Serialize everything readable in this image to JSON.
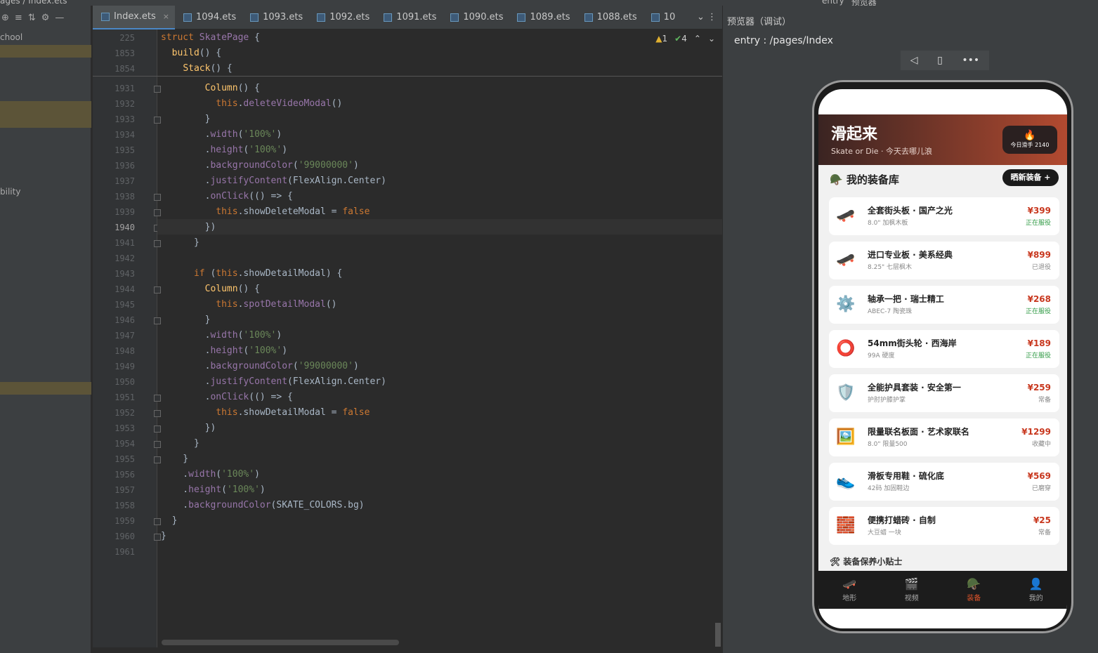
{
  "breadcrumb": {
    "part1": "ages",
    "part2": "Index.ets"
  },
  "topbar": {
    "entry": "entry",
    "previewer": "预览器"
  },
  "project": {
    "row1": "chool",
    "row2": "bility"
  },
  "tabs": [
    {
      "label": "Index.ets",
      "active": true
    },
    {
      "label": "1094.ets"
    },
    {
      "label": "1093.ets"
    },
    {
      "label": "1092.ets"
    },
    {
      "label": "1091.ets"
    },
    {
      "label": "1090.ets"
    },
    {
      "label": "1089.ets"
    },
    {
      "label": "1088.ets"
    },
    {
      "label": "10"
    }
  ],
  "inspections": {
    "warnings": "1",
    "ok": "4"
  },
  "editor": {
    "sticky": [
      {
        "ln": "225",
        "code": "struct SkatePage {"
      },
      {
        "ln": "1853",
        "code": "  build() {"
      },
      {
        "ln": "1854",
        "code": "    Stack() {"
      }
    ],
    "lines": [
      {
        "ln": "1931",
        "code": "        Column() {"
      },
      {
        "ln": "1932",
        "code": "          this.deleteVideoModal()"
      },
      {
        "ln": "1933",
        "code": "        }"
      },
      {
        "ln": "1934",
        "code": "        .width('100%')"
      },
      {
        "ln": "1935",
        "code": "        .height('100%')"
      },
      {
        "ln": "1936",
        "code": "        .backgroundColor('99000000')"
      },
      {
        "ln": "1937",
        "code": "        .justifyContent(FlexAlign.Center)"
      },
      {
        "ln": "1938",
        "code": "        .onClick(() => {"
      },
      {
        "ln": "1939",
        "code": "          this.showDeleteModal = false"
      },
      {
        "ln": "1940",
        "code": "        })"
      },
      {
        "ln": "1941",
        "code": "      }"
      },
      {
        "ln": "1942",
        "code": ""
      },
      {
        "ln": "1943",
        "code": "      if (this.showDetailModal) {"
      },
      {
        "ln": "1944",
        "code": "        Column() {"
      },
      {
        "ln": "1945",
        "code": "          this.spotDetailModal()"
      },
      {
        "ln": "1946",
        "code": "        }"
      },
      {
        "ln": "1947",
        "code": "        .width('100%')"
      },
      {
        "ln": "1948",
        "code": "        .height('100%')"
      },
      {
        "ln": "1949",
        "code": "        .backgroundColor('99000000')"
      },
      {
        "ln": "1950",
        "code": "        .justifyContent(FlexAlign.Center)"
      },
      {
        "ln": "1951",
        "code": "        .onClick(() => {"
      },
      {
        "ln": "1952",
        "code": "          this.showDetailModal = false"
      },
      {
        "ln": "1953",
        "code": "        })"
      },
      {
        "ln": "1954",
        "code": "      }"
      },
      {
        "ln": "1955",
        "code": "    }"
      },
      {
        "ln": "1956",
        "code": "    .width('100%')"
      },
      {
        "ln": "1957",
        "code": "    .height('100%')"
      },
      {
        "ln": "1958",
        "code": "    .backgroundColor(SKATE_COLORS.bg)"
      },
      {
        "ln": "1959",
        "code": "  }"
      },
      {
        "ln": "1960",
        "code": "}"
      },
      {
        "ln": "1961",
        "code": ""
      }
    ],
    "current_line": "1940"
  },
  "preview": {
    "title": "预览器（调试）",
    "path": "entry : /pages/Index",
    "app": {
      "title": "滑起来",
      "subtitle": "Skate or Die · 今天去哪儿浪",
      "badge_icon": "🔥",
      "badge_text": "今日滑手 2140",
      "section": "我的装备库",
      "section_icon": "🪖",
      "share_button": "晒新装备 +",
      "items": [
        {
          "icon": "🛹",
          "name": "全套街头板 · 国产之光",
          "desc": "8.0\" 加枫木板",
          "price": "¥399",
          "status": "正在服役",
          "status_color": "#2f9a44"
        },
        {
          "icon": "🛹",
          "name": "进口专业板 · 美系经典",
          "desc": "8.25\" 七层枫木",
          "price": "¥899",
          "status": "已退役",
          "status_color": "#888888"
        },
        {
          "icon": "⚙️",
          "name": "轴承一把 · 瑞士精工",
          "desc": "ABEC-7 陶瓷珠",
          "price": "¥268",
          "status": "正在服役",
          "status_color": "#2f9a44"
        },
        {
          "icon": "⭕",
          "name": "54mm街头轮 · 西海岸",
          "desc": "99A 硬度",
          "price": "¥189",
          "status": "正在服役",
          "status_color": "#2f9a44"
        },
        {
          "icon": "🛡️",
          "name": "全能护具套装 · 安全第一",
          "desc": "护肘护膝护掌",
          "price": "¥259",
          "status": "常备",
          "status_color": "#888888"
        },
        {
          "icon": "🖼️",
          "name": "限量联名板面 · 艺术家联名",
          "desc": "8.0\" 限量500",
          "price": "¥1299",
          "status": "收藏中",
          "status_color": "#888888"
        },
        {
          "icon": "👟",
          "name": "滑板专用鞋 · 硫化底",
          "desc": "42码 加固鞋边",
          "price": "¥569",
          "status": "已磨穿",
          "status_color": "#888888"
        },
        {
          "icon": "🧱",
          "name": "便携打蜡砖 · 自制",
          "desc": "大豆蜡 一块",
          "price": "¥25",
          "status": "常备",
          "status_color": "#888888"
        }
      ],
      "tips": "🛠 装备保养小贴士",
      "nav": [
        {
          "icon": "🛹",
          "label": "地形"
        },
        {
          "icon": "🎬",
          "label": "视频"
        },
        {
          "icon": "🪖",
          "label": "装备",
          "active": true
        },
        {
          "icon": "👤",
          "label": "我的"
        }
      ]
    }
  }
}
